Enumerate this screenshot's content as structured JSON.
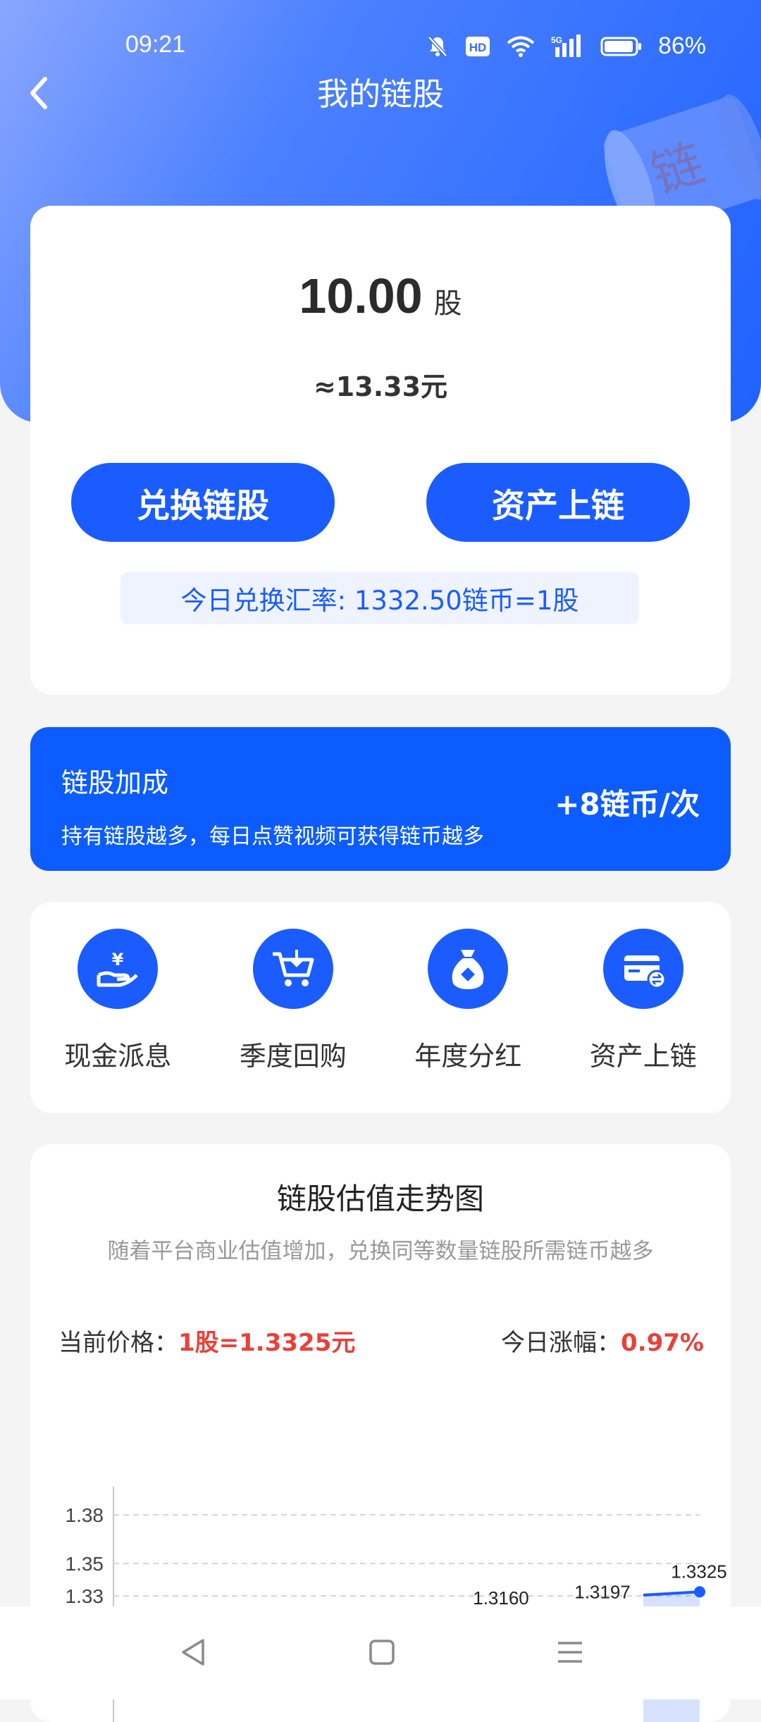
{
  "status_bar": {
    "time": "09:21",
    "battery_percent": "86%",
    "icons": [
      "mute-icon",
      "hd-icon",
      "wifi-icon",
      "signal-5g-icon",
      "battery-icon"
    ]
  },
  "nav": {
    "title": "我的链股",
    "back_icon": "chevron-left-icon"
  },
  "asset": {
    "amount": "10.00",
    "unit": "股",
    "approx_value": "≈13.33元",
    "exchange_button": "兑换链股",
    "chain_button": "资产上链",
    "rate_text": "今日兑换汇率: 1332.50链币=1股"
  },
  "bonus": {
    "title": "链股加成",
    "desc": "持有链股越多，每日点赞视频可获得链币越多",
    "value": "+8链币/次"
  },
  "features": [
    {
      "label": "现金派息",
      "icon": "yuan-hand-icon"
    },
    {
      "label": "季度回购",
      "icon": "cart-icon"
    },
    {
      "label": "年度分红",
      "icon": "money-bag-icon"
    },
    {
      "label": "资产上链",
      "icon": "card-exchange-icon"
    }
  ],
  "chart": {
    "title": "链股估值走势图",
    "subtitle": "随着平台商业估值增加，兑换同等数量链股所需链币越多",
    "price_label": "当前价格：",
    "price_value": "1股=1.3325元",
    "change_label": "今日涨幅：",
    "change_value": "0.97%"
  },
  "chart_data": {
    "type": "area",
    "title": "链股估值走势图",
    "y_ticks": [
      "1.38",
      "1.35",
      "1.33"
    ],
    "ylim": [
      1.3,
      1.39
    ],
    "grid": true,
    "points": [
      {
        "label": "1.3160",
        "value": 1.316
      },
      {
        "label": "1.3197",
        "value": 1.3197
      },
      {
        "label": "1.3325",
        "value": 1.3325
      }
    ],
    "accent_color": "#1a5cff"
  },
  "colors": {
    "accent": "#1a5cff",
    "bonus_bg": "#0c5cff",
    "highlight_red": "#e9413a"
  }
}
